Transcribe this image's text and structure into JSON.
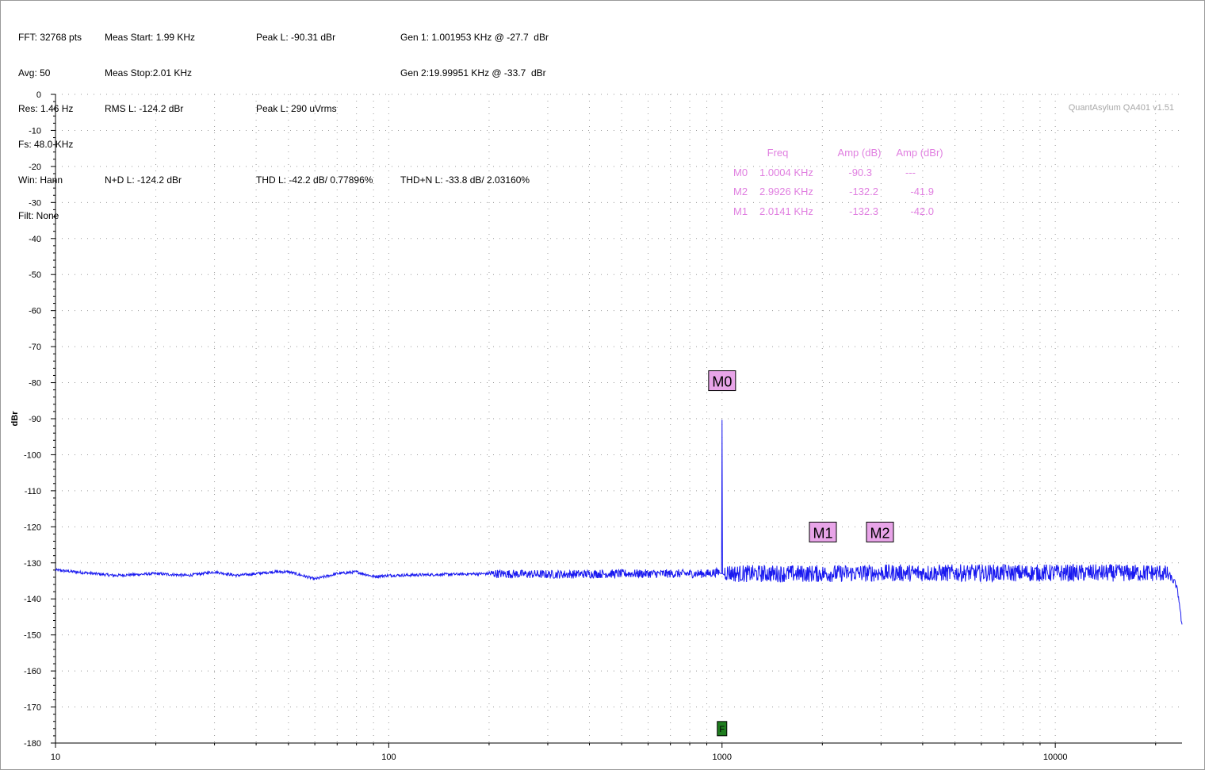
{
  "info": {
    "col1": [
      "FFT: 32768 pts",
      "Avg: 50",
      "Res: 1.46 Hz",
      "Fs: 48.0 KHz",
      "Win: Hann",
      "Filt: None"
    ],
    "meas_start": "Meas Start: 1.99 KHz",
    "meas_stop": "Meas Stop:2.01 KHz",
    "rms_l": "RMS L: -124.2 dBr",
    "nd_l": "N+D L: -124.2 dBr",
    "peak_l_db": "Peak L: -90.31 dBr",
    "peak_l_rms": "Peak L: 290 uVrms",
    "thd_l": "THD L: -42.2 dB/ 0.77896%",
    "gen1": "Gen 1: 1.001953 KHz @ -27.7  dBr",
    "gen2": "Gen 2:19.99951 KHz @ -33.7  dBr",
    "thdn_l": "THD+N L: -33.8 dB/ 2.03160%"
  },
  "watermark": "QuantAsylum QA401 v1.51",
  "marker_table": {
    "headers": [
      "Freq",
      "Amp (dB)",
      "Amp (dBr)"
    ],
    "rows": [
      {
        "name": "M0",
        "freq": "1.0004 KHz",
        "amp_db": "-90.3",
        "amp_dbr": "---"
      },
      {
        "name": "M2",
        "freq": "2.9926 KHz",
        "amp_db": "-132.2",
        "amp_dbr": "-41.9"
      },
      {
        "name": "M1",
        "freq": "2.0141 KHz",
        "amp_db": "-132.3",
        "amp_dbr": "-42.0"
      }
    ]
  },
  "colors": {
    "trace": "#1a1af0",
    "marker_fill": "#e8a4e8",
    "marker_text": "#e07fe0",
    "fundamental_flag": "#1e7d1e",
    "grid": "#9a9a9a"
  },
  "chart_data": {
    "type": "line",
    "title": "",
    "xlabel": "",
    "ylabel": "dBr",
    "x_scale": "log",
    "xlim": [
      10,
      24000
    ],
    "ylim": [
      -180,
      0
    ],
    "yticks": [
      0,
      -10,
      -20,
      -30,
      -40,
      -50,
      -60,
      -70,
      -80,
      -90,
      -100,
      -110,
      -120,
      -130,
      -140,
      -150,
      -160,
      -170,
      -180
    ],
    "xticks": [
      10,
      100,
      1000,
      10000
    ],
    "xtick_labels": [
      "10",
      "100",
      "1000",
      "10000"
    ],
    "grid": true,
    "legend": "none",
    "series": [
      {
        "x": [
          10,
          15,
          20,
          25,
          30,
          35,
          40,
          45,
          50,
          55,
          60,
          70,
          80,
          90,
          100,
          150,
          200,
          300,
          500,
          700,
          900,
          990,
          1000,
          1010,
          1100,
          1500,
          2000,
          3000,
          5000,
          8000,
          12000,
          18000,
          21000,
          22000,
          23000,
          23500,
          24000
        ],
        "y": [
          -132,
          -133.5,
          -133,
          -133.5,
          -132.5,
          -133.5,
          -133,
          -132.5,
          -132.5,
          -133.5,
          -134.5,
          -133,
          -132.5,
          -133.8,
          -133.5,
          -133.2,
          -133,
          -133.2,
          -133,
          -133,
          -133,
          -132.5,
          -90.3,
          -132.5,
          -133,
          -133,
          -133,
          -132.8,
          -132.8,
          -132.8,
          -132.8,
          -132.8,
          -132.8,
          -133.5,
          -136,
          -140,
          -148
        ]
      }
    ],
    "markers": [
      {
        "label": "M0",
        "freq": 1000.4,
        "amp": -90.3,
        "label_y": -80
      },
      {
        "label": "M1",
        "freq": 2014.1,
        "amp": -132.3,
        "label_y": -122
      },
      {
        "label": "M2",
        "freq": 2992.6,
        "amp": -132.2,
        "label_y": -122
      }
    ],
    "fundamental_flag": {
      "label": "F",
      "freq": 1000,
      "y": -176
    }
  }
}
